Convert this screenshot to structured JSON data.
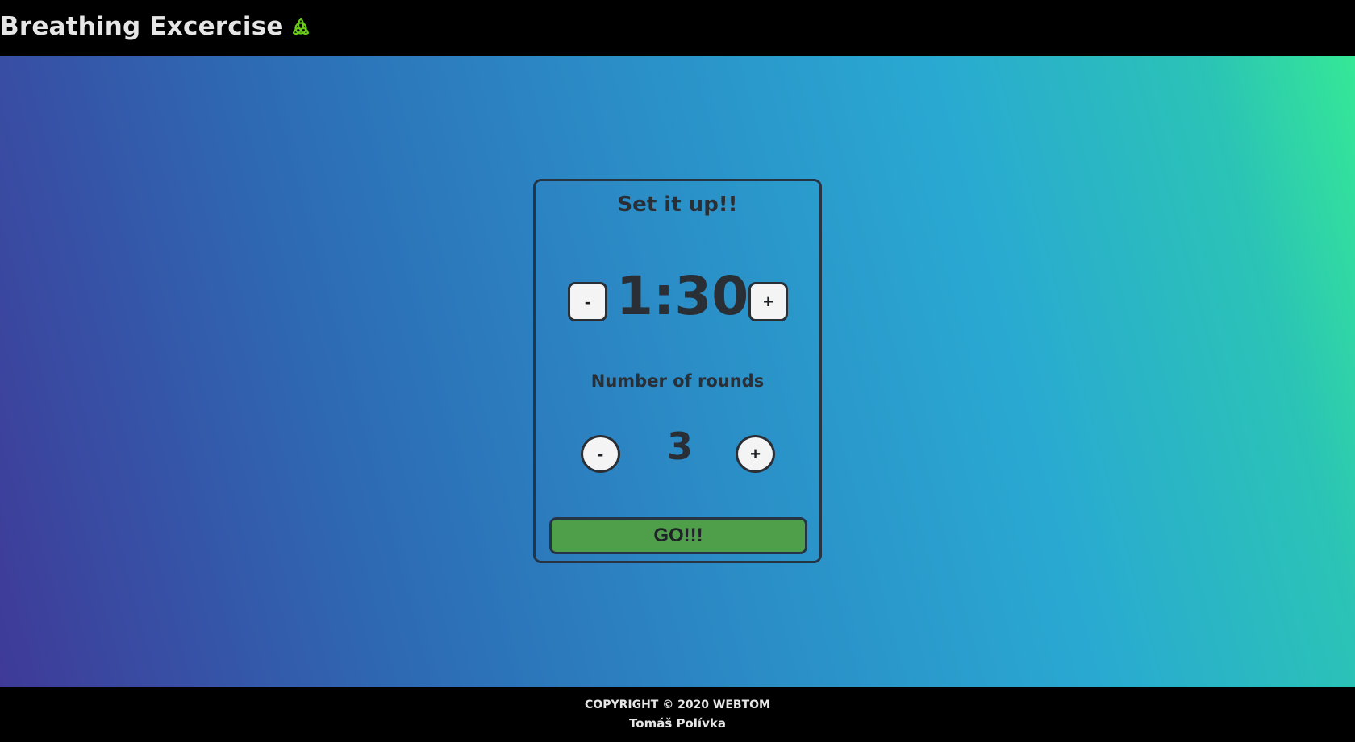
{
  "header": {
    "title": "Breathing Excercise",
    "icon": "triquetra-icon",
    "icon_color": "#6bcb1a"
  },
  "card": {
    "title": "Set it up!!",
    "time": {
      "decrease_label": "-",
      "value": "1:30",
      "increase_label": "+"
    },
    "rounds": {
      "label": "Number of rounds",
      "decrease_label": "-",
      "value": "3",
      "increase_label": "+"
    },
    "start_label": "GO!!!"
  },
  "footer": {
    "copyright": "COPYRIGHT © 2020 WEBTOM",
    "author": "Tomáš Polívka"
  },
  "colors": {
    "header_bg": "#000000",
    "gradient_start": "#3f3a98",
    "gradient_end": "#35e896",
    "go_button": "#4f9e49",
    "text_dark": "#2a2e35"
  }
}
